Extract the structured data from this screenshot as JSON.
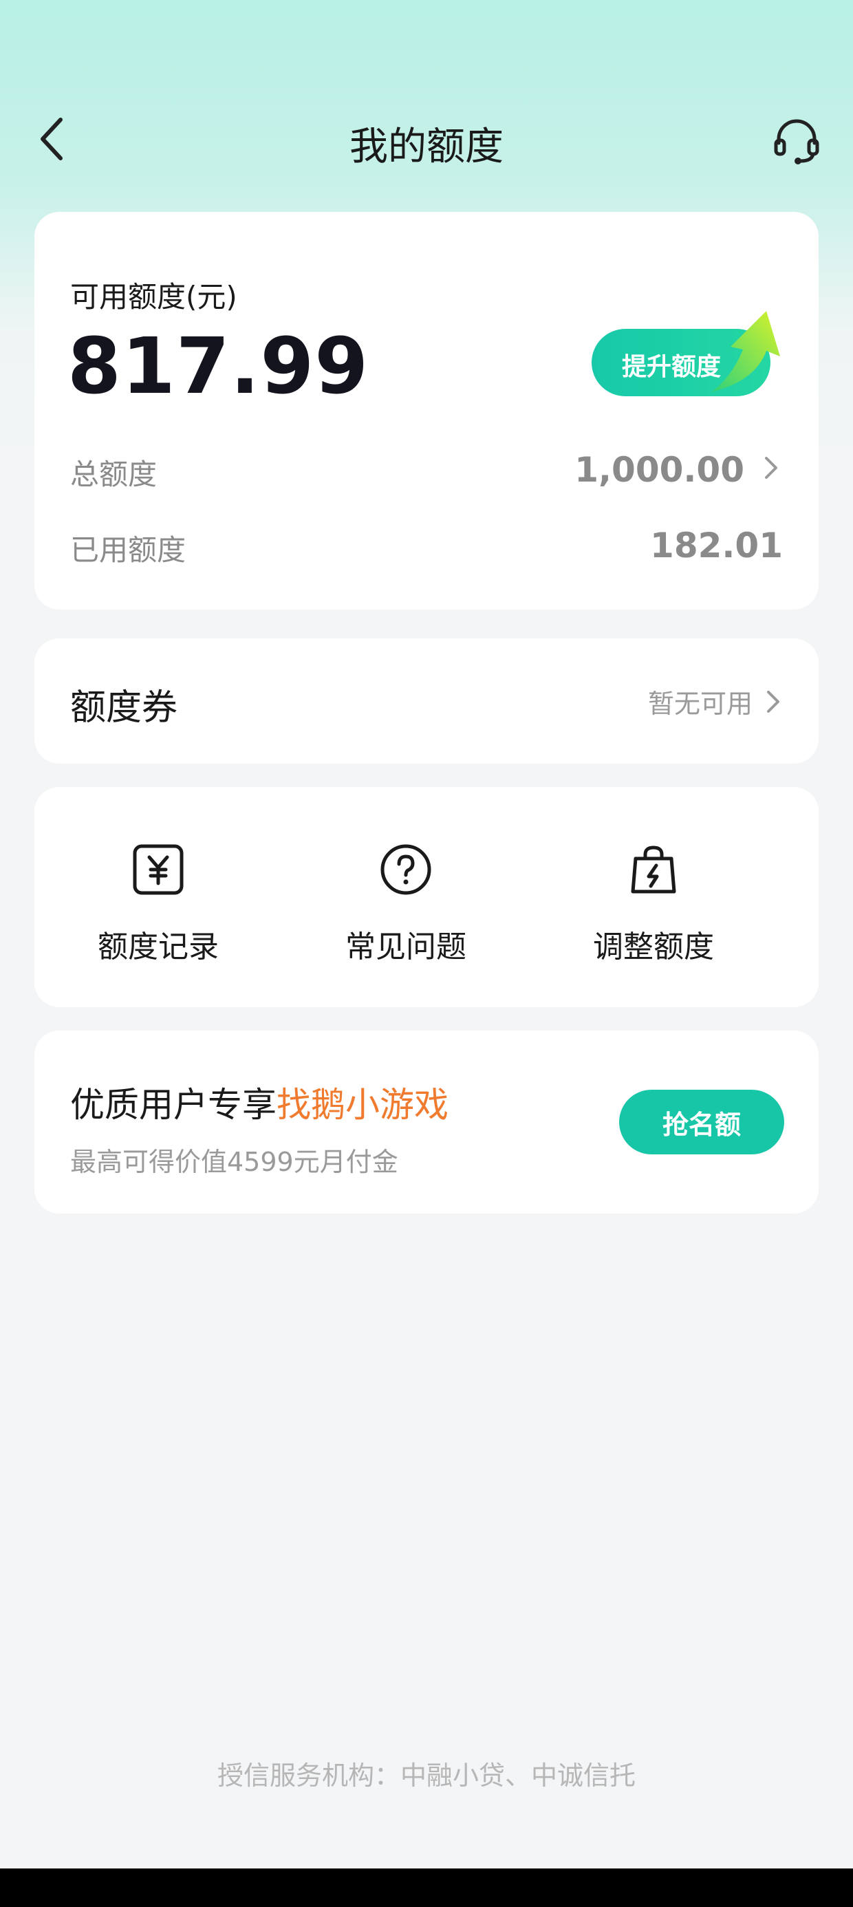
{
  "header": {
    "title": "我的额度",
    "back_icon": "back-arrow-icon",
    "service_icon": "headset-icon"
  },
  "credit": {
    "available_label": "可用额度(元)",
    "available_amount": "817.99",
    "raise_button": "提升额度",
    "total_label": "总额度",
    "total_value": "1,000.00",
    "used_label": "已用额度",
    "used_value": "182.01"
  },
  "coupon": {
    "title": "额度券",
    "status": "暂无可用"
  },
  "shortcuts": [
    {
      "label": "额度记录",
      "icon": "yuan-icon"
    },
    {
      "label": "常见问题",
      "icon": "question-icon"
    },
    {
      "label": "调整额度",
      "icon": "lightning-bag-icon"
    }
  ],
  "promo": {
    "title_prefix": "优质用户专享",
    "title_highlight": "找鹅小游戏",
    "subtitle": "最高可得价值4599元月付金",
    "button": "抢名额"
  },
  "footer": {
    "note": "授信服务机构：中融小贷、中诚信托"
  },
  "colors": {
    "accent": "#17c6a6",
    "highlight": "#f07a2e",
    "header_bg": "#b8f0e5"
  }
}
